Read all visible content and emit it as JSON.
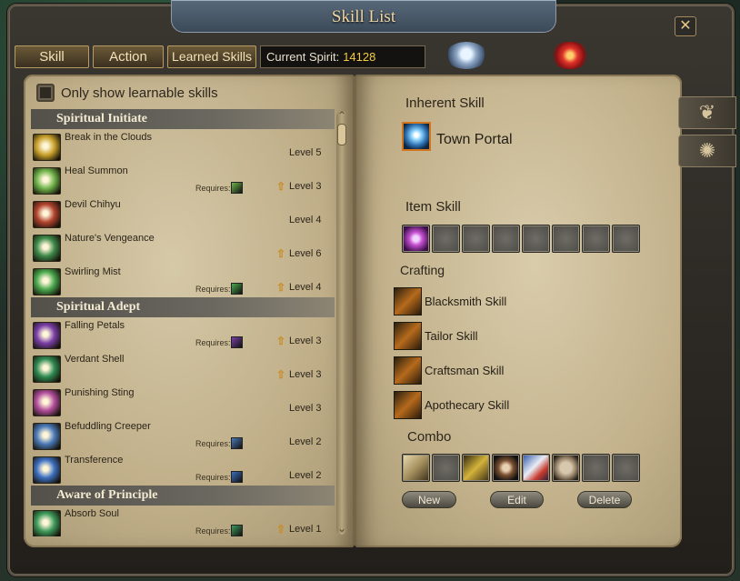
{
  "window": {
    "title": "Skill List",
    "close_glyph": "✕"
  },
  "toolbar": {
    "tabs": [
      {
        "label": "Skill"
      },
      {
        "label": "Action"
      },
      {
        "label": "Learned Skills"
      }
    ],
    "spirit_label": "Current Spirit:",
    "spirit_value": "14128"
  },
  "emblems": [
    "water-element-icon",
    "fire-element-icon"
  ],
  "left_page": {
    "checkbox_label": "Only show learnable skills",
    "requires_label": "Requires:",
    "sections": [
      {
        "title": "Spiritual Initiate",
        "skills": [
          {
            "name": "Break in the Clouds",
            "level": "Level 5",
            "requires": false,
            "learnable": false,
            "icon_color": "#c9a12b"
          },
          {
            "name": "Heal Summon",
            "level": "Level 3",
            "requires": true,
            "learnable": true,
            "icon_color": "#6fb34a"
          },
          {
            "name": "Devil Chihyu",
            "level": "Level 4",
            "requires": false,
            "learnable": false,
            "icon_color": "#b2432e"
          },
          {
            "name": "Nature's Vengeance",
            "level": "Level 6",
            "requires": false,
            "learnable": true,
            "icon_color": "#3f8a4a"
          },
          {
            "name": "Swirling Mist",
            "level": "Level 4",
            "requires": true,
            "learnable": true,
            "icon_color": "#4aa84e"
          }
        ]
      },
      {
        "title": "Spiritual Adept",
        "skills": [
          {
            "name": "Falling Petals",
            "level": "Level 3",
            "requires": true,
            "learnable": true,
            "icon_color": "#7a3fa8"
          },
          {
            "name": "Verdant Shell",
            "level": "Level 3",
            "requires": false,
            "learnable": true,
            "icon_color": "#2f8a52"
          },
          {
            "name": "Punishing Sting",
            "level": "Level 3",
            "requires": false,
            "learnable": false,
            "icon_color": "#b24e9c"
          },
          {
            "name": "Befuddling Creeper",
            "level": "Level 2",
            "requires": true,
            "learnable": false,
            "icon_color": "#4b7ab8"
          },
          {
            "name": "Transference",
            "level": "Level 2",
            "requires": true,
            "learnable": false,
            "icon_color": "#3d6fc0"
          }
        ]
      },
      {
        "title": "Aware of Principle",
        "skills": [
          {
            "name": "Absorb Soul",
            "level": "Level 1",
            "requires": true,
            "learnable": true,
            "icon_color": "#3d9a5a"
          }
        ]
      }
    ]
  },
  "right_page": {
    "inherent_heading": "Inherent Skill",
    "town_portal": "Town Portal",
    "item_heading": "Item Skill",
    "crafting_heading": "Crafting",
    "crafting": [
      {
        "label": "Blacksmith Skill"
      },
      {
        "label": "Tailor Skill"
      },
      {
        "label": "Craftsman Skill"
      },
      {
        "label": "Apothecary Skill"
      }
    ],
    "combo_heading": "Combo",
    "buttons": {
      "new": "New",
      "edit": "Edit",
      "delete": "Delete"
    }
  },
  "side_tabs": [
    "wing-emblem-icon",
    "swirl-emblem-icon"
  ]
}
